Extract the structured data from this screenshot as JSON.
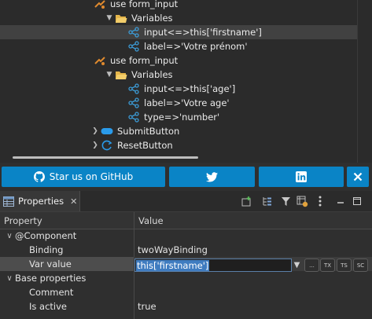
{
  "tree": {
    "items": [
      {
        "label": "use form_input",
        "icon": "component-icon"
      },
      {
        "label": "Variables",
        "icon": "folder-icon"
      },
      {
        "label": "input<=>this['firstname']",
        "icon": "share-node-icon"
      },
      {
        "label": "label=>'Votre prénom'",
        "icon": "share-node-icon"
      },
      {
        "label": "use form_input",
        "icon": "component-icon"
      },
      {
        "label": "Variables",
        "icon": "folder-icon"
      },
      {
        "label": "input<=>this['age']",
        "icon": "share-node-icon"
      },
      {
        "label": "label=>'Votre age'",
        "icon": "share-node-icon"
      },
      {
        "label": "type=>'number'",
        "icon": "share-node-icon"
      },
      {
        "label": "SubmitButton",
        "icon": "submit-button-icon"
      },
      {
        "label": "ResetButton",
        "icon": "reset-button-icon"
      }
    ]
  },
  "social": {
    "github_label": "Star us on GitHub",
    "github_icon": "github-icon",
    "twitter_icon": "twitter-icon",
    "linkedin_icon": "linkedin-icon",
    "close_icon": "close-icon",
    "button_color": "#0a84c6"
  },
  "properties": {
    "tab_title": "Properties",
    "columns": {
      "property": "Property",
      "value": "Value"
    },
    "groups": [
      {
        "label": "@Component",
        "rows": [
          {
            "name": "Binding",
            "value": "twoWayBinding"
          },
          {
            "name": "Var value",
            "value": "this['firstname']"
          }
        ]
      },
      {
        "label": "Base properties",
        "rows": [
          {
            "name": "Comment",
            "value": ""
          },
          {
            "name": "Is active",
            "value": "true"
          }
        ]
      }
    ],
    "editor_buttons": [
      "...",
      "TX",
      "TS",
      "SC"
    ],
    "selection_color": "#3f7cc0"
  }
}
